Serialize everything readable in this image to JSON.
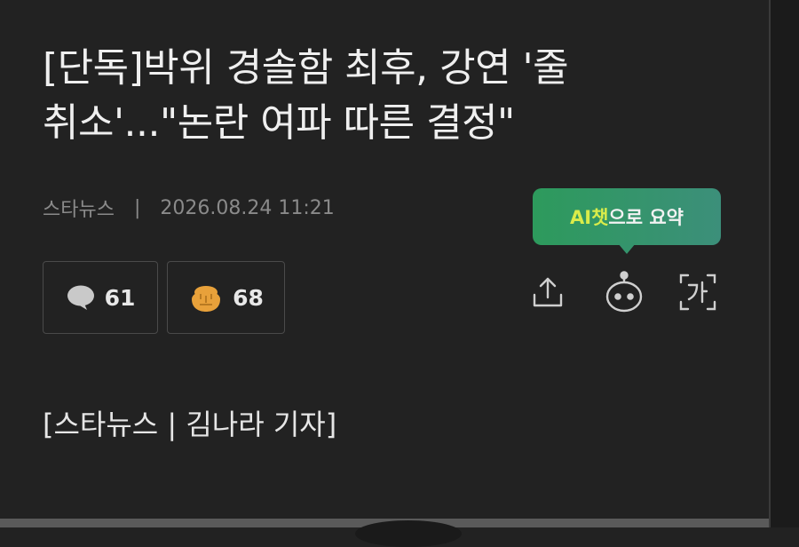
{
  "article": {
    "headline_line1": "[단독]박위 경솔함 최후, 강연 '줄",
    "headline_line2": "취소'...\"논란 여파 따른 결정\"",
    "source": "스타뉴스",
    "separator": "|",
    "datetime": "2026.08.24 11:21",
    "byline": "[스타뉴스 | 김나라 기자]"
  },
  "reactions": {
    "comments_count": "61",
    "likes_count": "68"
  },
  "tooltip": {
    "prefix": "AI챗",
    "suffix": "으로 요약"
  },
  "icons": {
    "comments": "speech-bubble-icon",
    "likes": "reaction-face-icon",
    "share": "share-icon",
    "ai_chat": "robot-icon",
    "font_size": "font-size-icon"
  },
  "colors": {
    "background": "#222222",
    "tooltip_green": "#2d9a5c",
    "tooltip_accent": "#d9ec4a",
    "like_orange": "#e8a13a"
  }
}
